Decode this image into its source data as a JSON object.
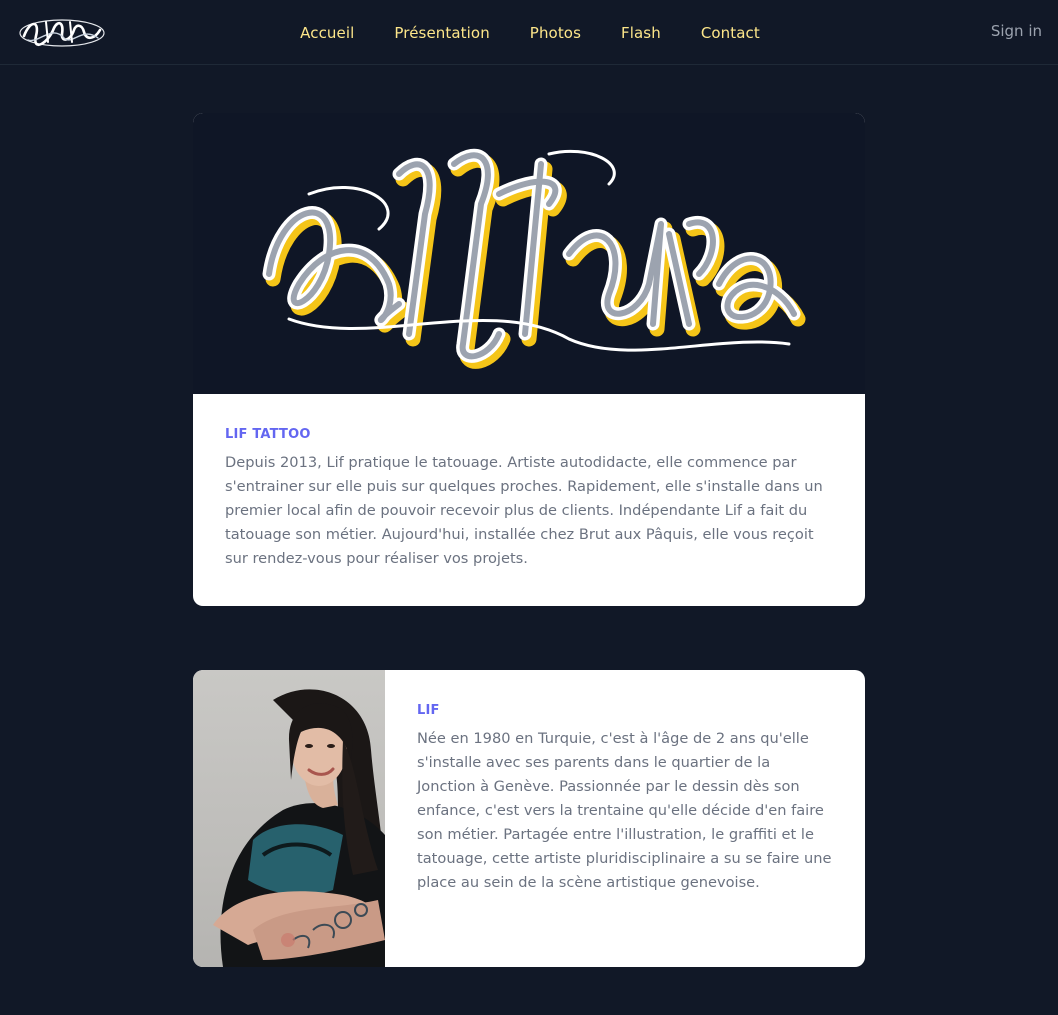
{
  "brand": {
    "logo_text": "Lif Tattoo"
  },
  "nav": {
    "items": [
      "Accueil",
      "Présentation",
      "Photos",
      "Flash",
      "Contact"
    ],
    "sign_in": "Sign in"
  },
  "colors": {
    "background": "#111827",
    "nav_link": "#fde68a",
    "accent": "#6366f1",
    "logo_gold": "#f5c518"
  },
  "intro": {
    "hero_logo_text": "Lif Tattoo",
    "eyebrow": "LIF TATTOO",
    "text": "Depuis 2013, Lif pratique le tatouage. Artiste autodidacte, elle commence par s'entrainer sur elle puis sur quelques proches. Rapidement, elle s'installe dans un premier local afin de pouvoir recevoir plus de clients. Indépendante Lif a fait du tatouage son métier. Aujourd'hui, installée chez Brut aux Pâquis, elle vous reçoit sur rendez-vous pour réaliser vos projets."
  },
  "artist": {
    "eyebrow": "LIF",
    "text": "Née en 1980 en Turquie, c'est à l'âge de 2 ans qu'elle s'installe avec ses parents dans le quartier de la Jonction à Genève. Passionnée par le dessin dès son enfance, c'est vers la trentaine qu'elle décide d'en faire son métier. Partagée entre l'illustration, le graffiti et le tatouage, cette artiste pluridisciplinaire a su se faire une place au sein de la scène artistique genevoise."
  }
}
